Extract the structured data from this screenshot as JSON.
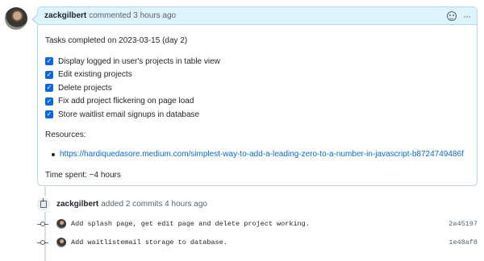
{
  "comment": {
    "author": "zackgilbert",
    "action": "commented 3 hours ago",
    "icons": [
      "smiley-icon",
      "kebab-horizontal-icon"
    ],
    "more_label": "···",
    "tasks_title": "Tasks completed on 2023-03-15 (day 2)",
    "tasks": [
      {
        "label": "Display logged in user's projects in table view",
        "checked": true
      },
      {
        "label": "Edit existing projects",
        "checked": true
      },
      {
        "label": "Delete projects",
        "checked": true
      },
      {
        "label": "Fix add project flickering on page load",
        "checked": true
      },
      {
        "label": "Store waitlist email signups in database",
        "checked": true
      }
    ],
    "resources_label": "Resources:",
    "resources": [
      "https://hardiquedasore.medium.com/simplest-way-to-add-a-leading-zero-to-a-number-in-javascript-b8724749486f"
    ],
    "time_spent": "Time spent: ~4 hours"
  },
  "push_event": {
    "author": "zackgilbert",
    "text": "added 2 commits 4 hours ago"
  },
  "commits": [
    {
      "message": "Add splash page, get edit page and delete project working.",
      "sha": "2a45197"
    },
    {
      "message": "Add waitlistemail storage to database.",
      "sha": "1e48af8"
    }
  ],
  "colors": {
    "accent": "#0969da",
    "header_bg": "#ddf4ff",
    "border": "#b6d4f6"
  }
}
